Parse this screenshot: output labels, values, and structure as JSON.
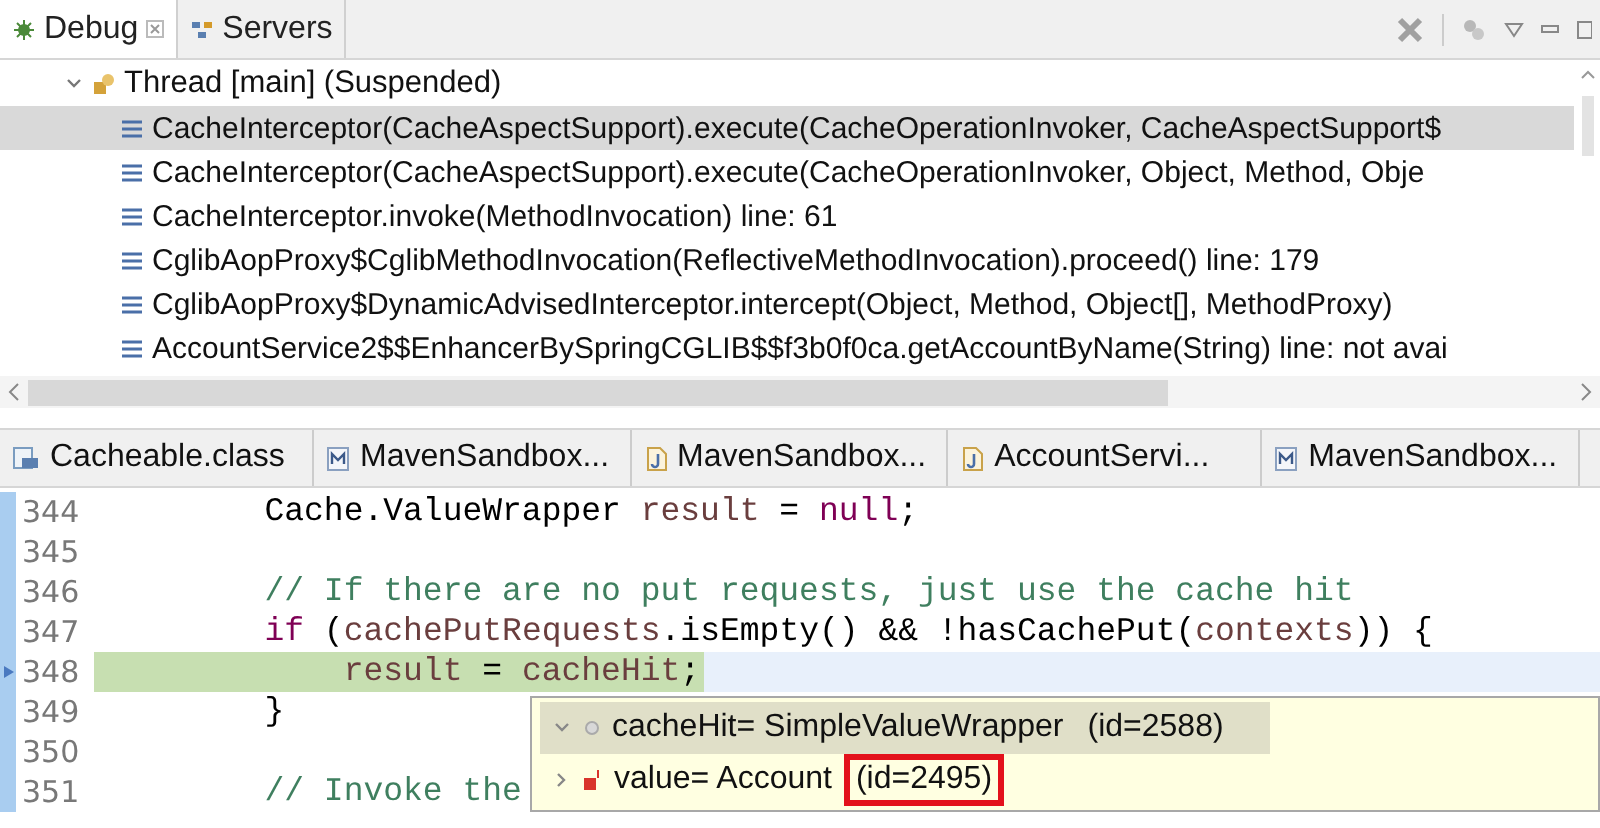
{
  "view_tabs": [
    {
      "label": "Debug",
      "kind": "debug",
      "selected": true
    },
    {
      "label": "Servers",
      "kind": "servers",
      "selected": false
    }
  ],
  "thread": {
    "label": "Thread [main] (Suspended)",
    "expanded": true
  },
  "stack_frames": [
    {
      "label": "CacheInterceptor(CacheAspectSupport).execute(CacheOperationInvoker, CacheAspectSupport$",
      "selected": true
    },
    {
      "label": "CacheInterceptor(CacheAspectSupport).execute(CacheOperationInvoker, Object, Method, Obje",
      "selected": false
    },
    {
      "label": "CacheInterceptor.invoke(MethodInvocation) line: 61",
      "selected": false
    },
    {
      "label": "CglibAopProxy$CglibMethodInvocation(ReflectiveMethodInvocation).proceed() line: 179",
      "selected": false
    },
    {
      "label": "CglibAopProxy$DynamicAdvisedInterceptor.intercept(Object, Method, Object[], MethodProxy)",
      "selected": false
    },
    {
      "label": "AccountService2$$EnhancerBySpringCGLIB$$f3b0f0ca.getAccountByName(String) line: not avai",
      "selected": false
    }
  ],
  "editor_tabs": [
    {
      "label": "Cacheable.class",
      "kind": "class",
      "selected": false
    },
    {
      "label": "MavenSandbox...",
      "kind": "xml",
      "selected": false
    },
    {
      "label": "MavenSandbox...",
      "kind": "java",
      "selected": false
    },
    {
      "label": "AccountServi...",
      "kind": "java",
      "selected": false
    },
    {
      "label": "MavenSandbox...",
      "kind": "xml",
      "selected": false
    }
  ],
  "code_lines": [
    {
      "number": "344",
      "current": false,
      "tokens": [
        {
          "text": "        Cache.ValueWrapper ",
          "kind": "plain"
        },
        {
          "text": "result",
          "kind": "var"
        },
        {
          "text": " = ",
          "kind": "plain"
        },
        {
          "text": "null",
          "kind": "keyword"
        },
        {
          "text": ";",
          "kind": "plain"
        }
      ]
    },
    {
      "number": "345",
      "current": false
    },
    {
      "number": "346",
      "current": false,
      "tokens": [
        {
          "text": "        // If there are no put requests, just use the cache hit",
          "kind": "comment"
        }
      ]
    },
    {
      "number": "347",
      "current": false,
      "tokens": [
        {
          "text": "        if",
          "kind": "keyword"
        },
        {
          "text": " (",
          "kind": "plain"
        },
        {
          "text": "cachePutRequests",
          "kind": "var"
        },
        {
          "text": ".isEmpty() && !hasCachePut(",
          "kind": "plain"
        },
        {
          "text": "contexts",
          "kind": "var"
        },
        {
          "text": ")) {",
          "kind": "plain"
        }
      ]
    },
    {
      "number": "348",
      "current": true,
      "tokens": [
        {
          "text": "            result",
          "kind": "var"
        },
        {
          "text": " = ",
          "kind": "plain"
        },
        {
          "text": "cacheHit",
          "kind": "var"
        },
        {
          "text": ";",
          "kind": "plain"
        }
      ]
    },
    {
      "number": "349",
      "current": false,
      "tokens": [
        {
          "text": "        }",
          "kind": "plain"
        }
      ]
    },
    {
      "number": "350",
      "current": false
    },
    {
      "number": "351",
      "current": false,
      "tokens": [
        {
          "text": "        // Invoke the",
          "kind": "comment"
        }
      ]
    }
  ],
  "hover_popup": {
    "variables": [
      {
        "name": "cacheHit= SimpleValueWrapper",
        "id": "(id=2588)",
        "expanded": true,
        "selected": true,
        "kind": "local",
        "highlighted": false,
        "children": [
          {
            "name": "value= Account",
            "id": "(id=2495)",
            "expanded": false,
            "selected": false,
            "kind": "field",
            "highlighted": true
          }
        ]
      }
    ]
  }
}
